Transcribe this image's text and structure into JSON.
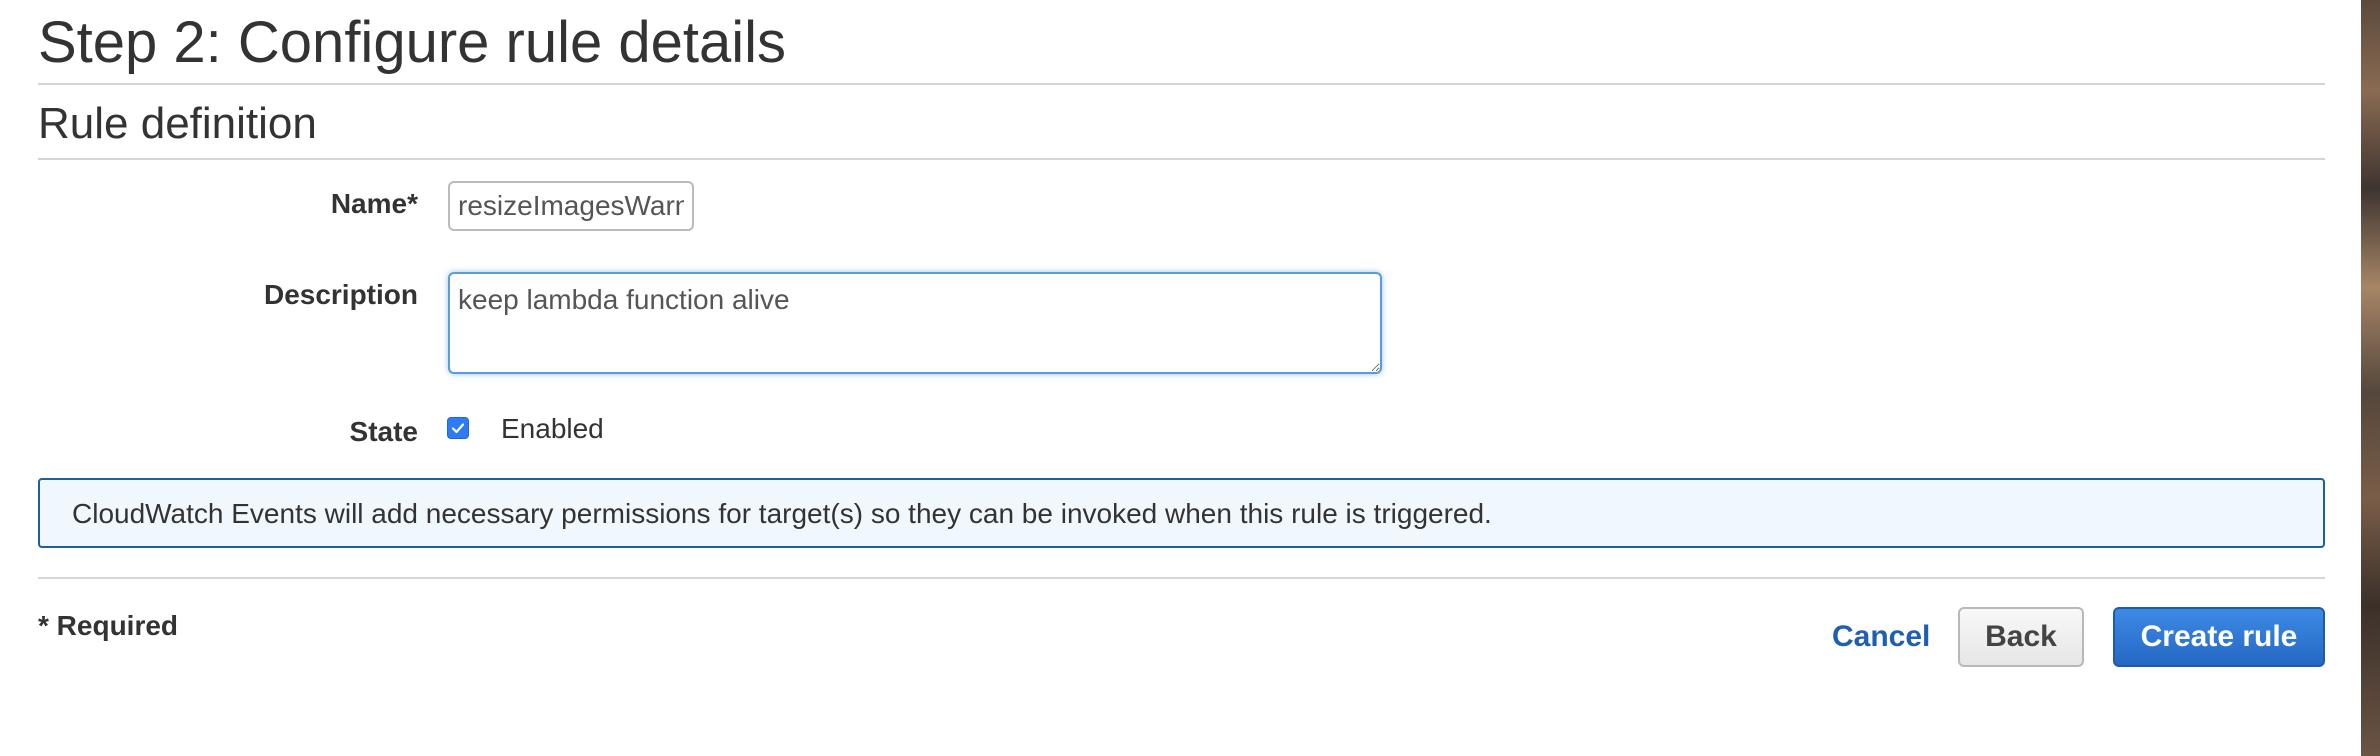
{
  "page": {
    "title": "Step 2: Configure rule details",
    "section_title": "Rule definition"
  },
  "form": {
    "name_label": "Name*",
    "name_value": "resizeImagesWarmer",
    "description_label": "Description",
    "description_value": "keep lambda function alive",
    "state_label": "State",
    "state_checkbox_label": "Enabled",
    "state_checked": true
  },
  "info": {
    "message": "CloudWatch Events will add necessary permissions for target(s) so they can be invoked when this rule is triggered."
  },
  "footer": {
    "required_note": "* Required",
    "cancel_label": "Cancel",
    "back_label": "Back",
    "create_label": "Create rule"
  },
  "colors": {
    "primary_button": "#2468c4",
    "link": "#1f5eb0",
    "checkbox": "#2d7cf6",
    "info_border": "#1f5e9c",
    "info_background": "#f1f8fd"
  }
}
